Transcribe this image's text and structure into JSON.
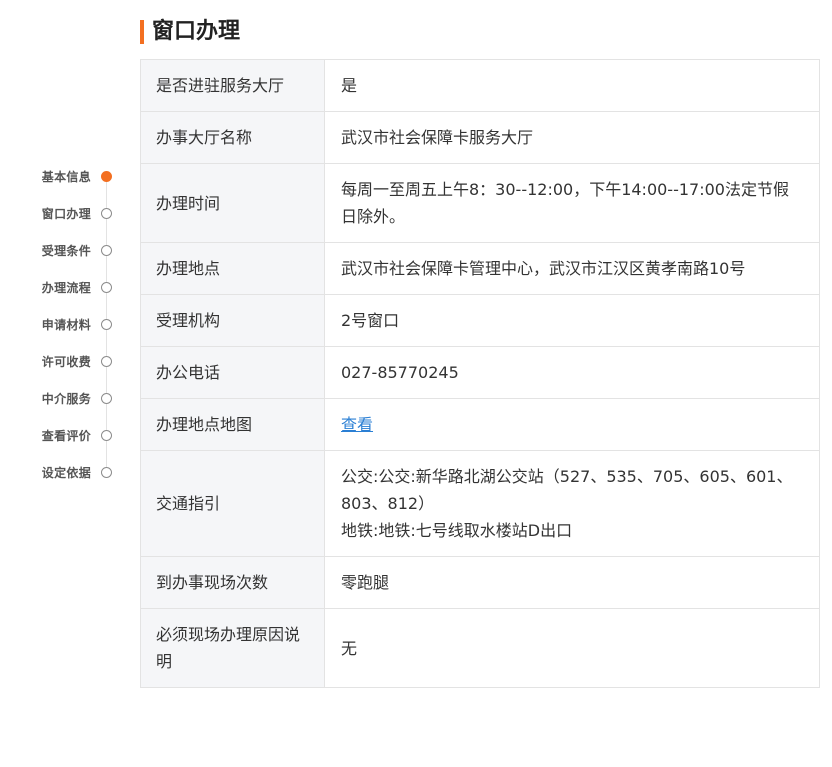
{
  "sidebar": {
    "items": [
      {
        "label": "基本信息",
        "active": true
      },
      {
        "label": "窗口办理",
        "active": false
      },
      {
        "label": "受理条件",
        "active": false
      },
      {
        "label": "办理流程",
        "active": false
      },
      {
        "label": "申请材料",
        "active": false
      },
      {
        "label": "许可收费",
        "active": false
      },
      {
        "label": "中介服务",
        "active": false
      },
      {
        "label": "查看评价",
        "active": false
      },
      {
        "label": "设定依据",
        "active": false
      }
    ]
  },
  "section": {
    "title": "窗口办理"
  },
  "rows": [
    {
      "label": "是否进驻服务大厅",
      "value": "是"
    },
    {
      "label": "办事大厅名称",
      "value": "武汉市社会保障卡服务大厅"
    },
    {
      "label": "办理时间",
      "value": "每周一至周五上午8：30--12:00，下午14:00--17:00法定节假日除外。"
    },
    {
      "label": "办理地点",
      "value": "武汉市社会保障卡管理中心，武汉市江汉区黄孝南路10号"
    },
    {
      "label": "受理机构",
      "value": "2号窗口"
    },
    {
      "label": "办公电话",
      "value": "027-85770245"
    },
    {
      "label": "办理地点地图",
      "value": "查看"
    },
    {
      "label": "交通指引",
      "lines": [
        "公交:公交:新华路北湖公交站（527、535、705、605、601、803、812）",
        "地铁:地铁:七号线取水楼站D出口"
      ]
    },
    {
      "label": "到办事现场次数",
      "value": "零跑腿"
    },
    {
      "label": "必须现场办理原因说明",
      "value": "无"
    }
  ],
  "colors": {
    "accent": "#f36f21",
    "link": "#2a7fd4",
    "label_bg": "#f5f6f8",
    "border": "#e3e3e3"
  }
}
